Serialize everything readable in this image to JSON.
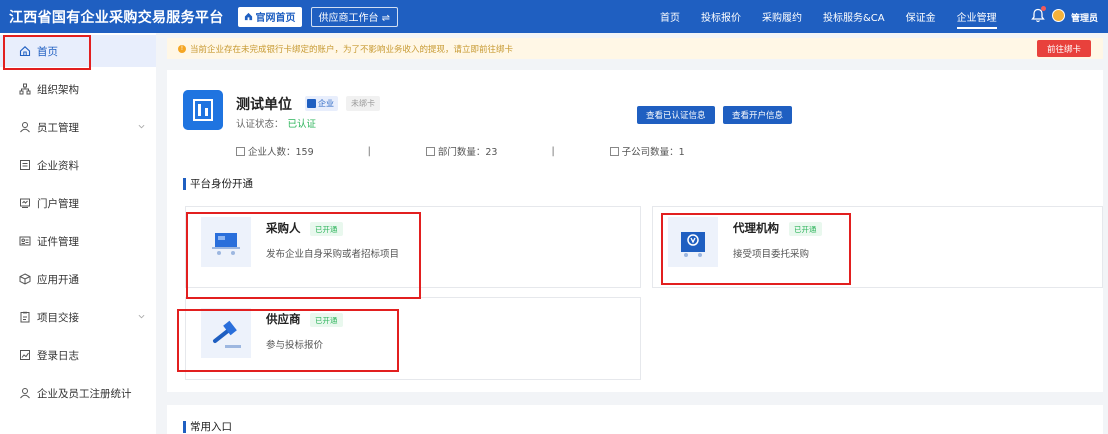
{
  "header": {
    "brand": "江西省国有企业采购交易服务平台",
    "home_button": "官网首页",
    "workspace_button": "供应商工作台 ⇌",
    "nav": [
      "首页",
      "投标报价",
      "采购履约",
      "投标服务&CA",
      "保证金",
      "企业管理"
    ],
    "active_nav": "企业管理",
    "user": "管理员"
  },
  "sidebar": {
    "items": [
      {
        "label": "首页",
        "icon": "home-icon"
      },
      {
        "label": "组织架构",
        "icon": "org-icon"
      },
      {
        "label": "员工管理",
        "icon": "user-icon"
      },
      {
        "label": "企业资料",
        "icon": "document-icon"
      },
      {
        "label": "门户管理",
        "icon": "portal-icon"
      },
      {
        "label": "证件管理",
        "icon": "id-card-icon"
      },
      {
        "label": "应用开通",
        "icon": "app-icon"
      },
      {
        "label": "项目交接",
        "icon": "handover-icon"
      },
      {
        "label": "登录日志",
        "icon": "log-icon"
      },
      {
        "label": "企业及员工注册统计",
        "icon": "stats-icon"
      }
    ]
  },
  "notice": {
    "text": "当前企业存在未完成银行卡绑定的账户，为了不影响业务收入的提现，请立即前往绑卡",
    "button": "前往绑卡"
  },
  "org": {
    "name": "测试单位",
    "type_tag": "企业",
    "bind_tag": "未绑卡",
    "cert_label": "认证状态：",
    "cert_value": "已认证",
    "stat_people": "企业人数：159",
    "stat_sep": "|",
    "stat_depts": "部门数量：23",
    "stat_subs": "子公司数量：1",
    "btn_cert_info": "查看已认证信息",
    "btn_account_info": "查看开户信息"
  },
  "platform": {
    "title": "平台身份开通",
    "roles": [
      {
        "name": "采购人",
        "tag": "已开通",
        "desc": "发布企业自身采购或者招标项目",
        "icon": "cart-icon"
      },
      {
        "name": "代理机构",
        "tag": "已开通",
        "desc": "接受项目委托采购",
        "icon": "agency-icon"
      },
      {
        "name": "供应商",
        "tag": "已开通",
        "desc": "参与投标报价",
        "icon": "gavel-icon"
      }
    ]
  },
  "common": {
    "title": "常用入口"
  },
  "colors": {
    "primary": "#1f5fc1",
    "success": "#2db45b",
    "danger": "#e8413c",
    "highlight": "#e21f1f"
  }
}
